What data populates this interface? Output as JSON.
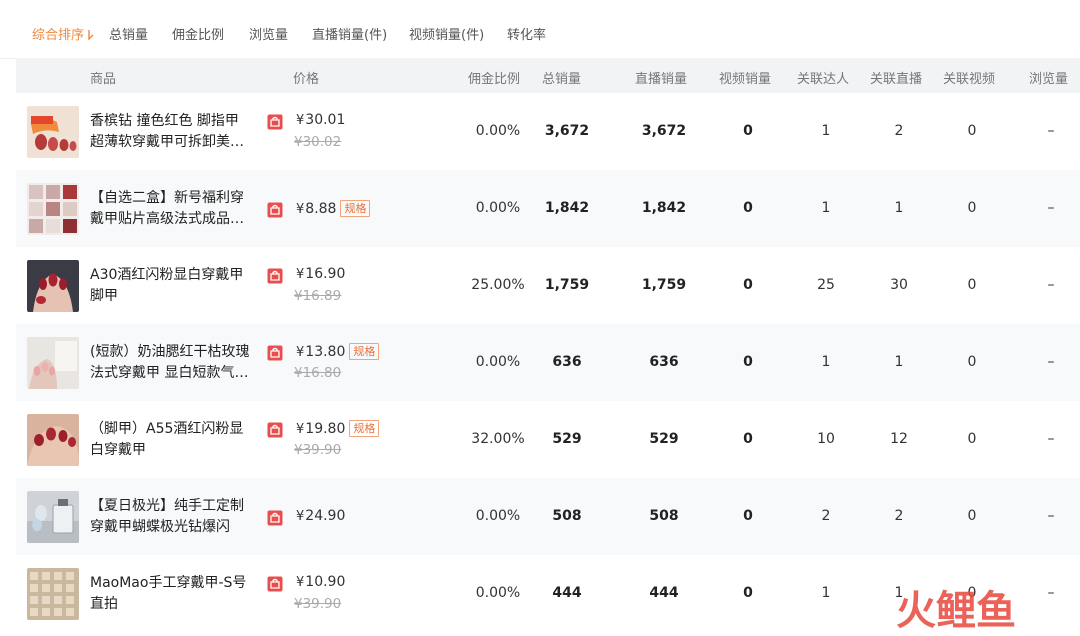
{
  "sort_tabs": [
    {
      "label": "综合排序",
      "active": true
    },
    {
      "label": "总销量",
      "active": false
    },
    {
      "label": "佣金比例",
      "active": false
    },
    {
      "label": "浏览量",
      "active": false
    },
    {
      "label": "直播销量(件)",
      "active": false
    },
    {
      "label": "视频销量(件)",
      "active": false
    },
    {
      "label": "转化率",
      "active": false
    }
  ],
  "columns": {
    "product": "商品",
    "price": "价格",
    "commission": "佣金比例",
    "total_sales": "总销量",
    "live_sales": "直播销量",
    "video_sales": "视频销量",
    "influencers": "关联达人",
    "lives": "关联直播",
    "videos": "关联视频",
    "views": "浏览量"
  },
  "rows": [
    {
      "name_l1": "香槟钻 撞色红色 脚指甲",
      "name_l2": "超薄软穿戴甲可拆卸美…",
      "price": "30.01",
      "original_price": "¥30.02",
      "spec": "",
      "commission": "0.00%",
      "total_sales": "3,672",
      "live_sales": "3,672",
      "video_sales": "0",
      "influencers": "1",
      "lives": "2",
      "videos": "0",
      "views": "–",
      "thumb": "thumb-nail-1"
    },
    {
      "name_l1": "【自选二盒】新号福利穿",
      "name_l2": "戴甲贴片高级法式成品…",
      "price": "8.88",
      "original_price": "",
      "spec": "规格",
      "commission": "0.00%",
      "total_sales": "1,842",
      "live_sales": "1,842",
      "video_sales": "0",
      "influencers": "1",
      "lives": "1",
      "videos": "0",
      "views": "–",
      "thumb": "thumb-nail-2"
    },
    {
      "name_l1": "A30酒红闪粉显白穿戴甲",
      "name_l2": "脚甲",
      "price": "16.90",
      "original_price": "¥16.89",
      "spec": "",
      "commission": "25.00%",
      "total_sales": "1,759",
      "live_sales": "1,759",
      "video_sales": "0",
      "influencers": "25",
      "lives": "30",
      "videos": "0",
      "views": "–",
      "thumb": "thumb-nail-3"
    },
    {
      "name_l1": "(短款）奶油腮红干枯玫瑰",
      "name_l2": "法式穿戴甲 显白短款气…",
      "price": "13.80",
      "original_price": "¥16.80",
      "spec": "规格",
      "commission": "0.00%",
      "total_sales": "636",
      "live_sales": "636",
      "video_sales": "0",
      "influencers": "1",
      "lives": "1",
      "videos": "0",
      "views": "–",
      "thumb": "thumb-nail-4"
    },
    {
      "name_l1": "（脚甲）A55酒红闪粉显",
      "name_l2": "白穿戴甲",
      "price": "19.80",
      "original_price": "¥39.90",
      "spec": "规格",
      "commission": "32.00%",
      "total_sales": "529",
      "live_sales": "529",
      "video_sales": "0",
      "influencers": "10",
      "lives": "12",
      "videos": "0",
      "views": "–",
      "thumb": "thumb-nail-5"
    },
    {
      "name_l1": "【夏日极光】纯手工定制",
      "name_l2": "穿戴甲蝴蝶极光钻爆闪",
      "price": "24.90",
      "original_price": "",
      "spec": "",
      "commission": "0.00%",
      "total_sales": "508",
      "live_sales": "508",
      "video_sales": "0",
      "influencers": "2",
      "lives": "2",
      "videos": "0",
      "views": "–",
      "thumb": "thumb-nail-6"
    },
    {
      "name_l1": "MaoMao手工穿戴甲-S号",
      "name_l2": "直拍",
      "price": "10.90",
      "original_price": "¥39.90",
      "spec": "",
      "commission": "0.00%",
      "total_sales": "444",
      "live_sales": "444",
      "video_sales": "0",
      "influencers": "1",
      "lives": "1",
      "videos": "0",
      "views": "–",
      "thumb": "thumb-nail-7"
    }
  ],
  "currency": "¥",
  "watermark": {
    "text": "火鲤鱼"
  },
  "colors": {
    "accent": "#f0883a",
    "shop_icon": "#e84e4e",
    "spec_border": "#f2a37a",
    "row_alt": "#f8f9fa",
    "header_bg": "#f2f3f5"
  }
}
